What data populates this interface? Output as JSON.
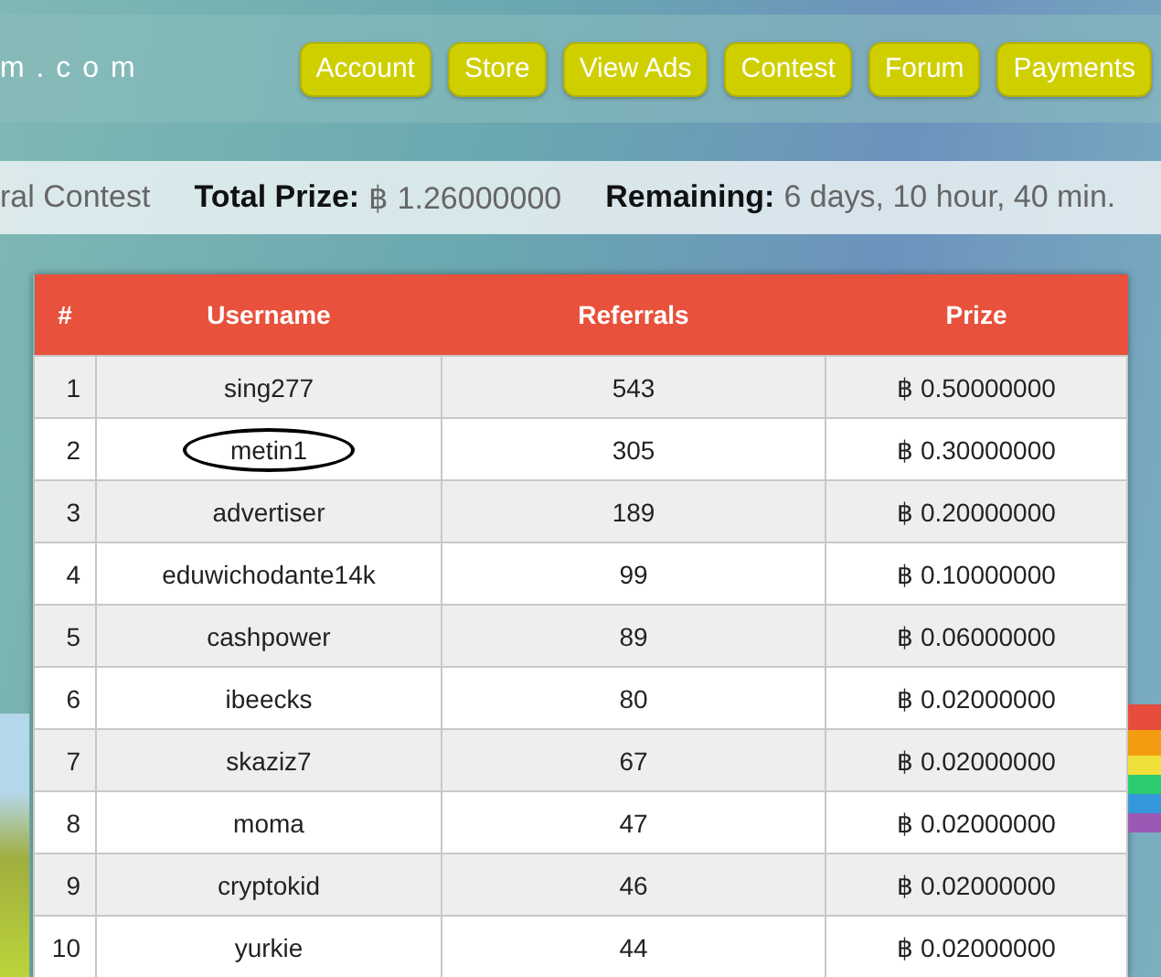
{
  "header": {
    "logo": "m . c o m",
    "nav": [
      {
        "label": "Account"
      },
      {
        "label": "Store"
      },
      {
        "label": "View Ads"
      },
      {
        "label": "Contest"
      },
      {
        "label": "Forum"
      },
      {
        "label": "Payments"
      }
    ]
  },
  "contest_bar": {
    "title": "ral Contest",
    "total_prize_label": "Total Prize:",
    "total_prize": "฿ 1.26000000",
    "remaining_label": "Remaining:",
    "remaining": "6 days, 10 hour, 40 min."
  },
  "table": {
    "columns": [
      "#",
      "Username",
      "Referrals",
      "Prize"
    ],
    "rows": [
      {
        "rank": "1",
        "username": "sing277",
        "referrals": "543",
        "prize": "฿ 0.50000000",
        "circled": false
      },
      {
        "rank": "2",
        "username": "metin1",
        "referrals": "305",
        "prize": "฿ 0.30000000",
        "circled": true
      },
      {
        "rank": "3",
        "username": "advertiser",
        "referrals": "189",
        "prize": "฿ 0.20000000",
        "circled": false
      },
      {
        "rank": "4",
        "username": "eduwichodante14k",
        "referrals": "99",
        "prize": "฿ 0.10000000",
        "circled": false
      },
      {
        "rank": "5",
        "username": "cashpower",
        "referrals": "89",
        "prize": "฿ 0.06000000",
        "circled": false
      },
      {
        "rank": "6",
        "username": "ibeecks",
        "referrals": "80",
        "prize": "฿ 0.02000000",
        "circled": false
      },
      {
        "rank": "7",
        "username": "skaziz7",
        "referrals": "67",
        "prize": "฿ 0.02000000",
        "circled": false
      },
      {
        "rank": "8",
        "username": "moma",
        "referrals": "47",
        "prize": "฿ 0.02000000",
        "circled": false
      },
      {
        "rank": "9",
        "username": "cryptokid",
        "referrals": "46",
        "prize": "฿ 0.02000000",
        "circled": false
      },
      {
        "rank": "10",
        "username": "yurkie",
        "referrals": "44",
        "prize": "฿ 0.02000000",
        "circled": false
      }
    ]
  }
}
